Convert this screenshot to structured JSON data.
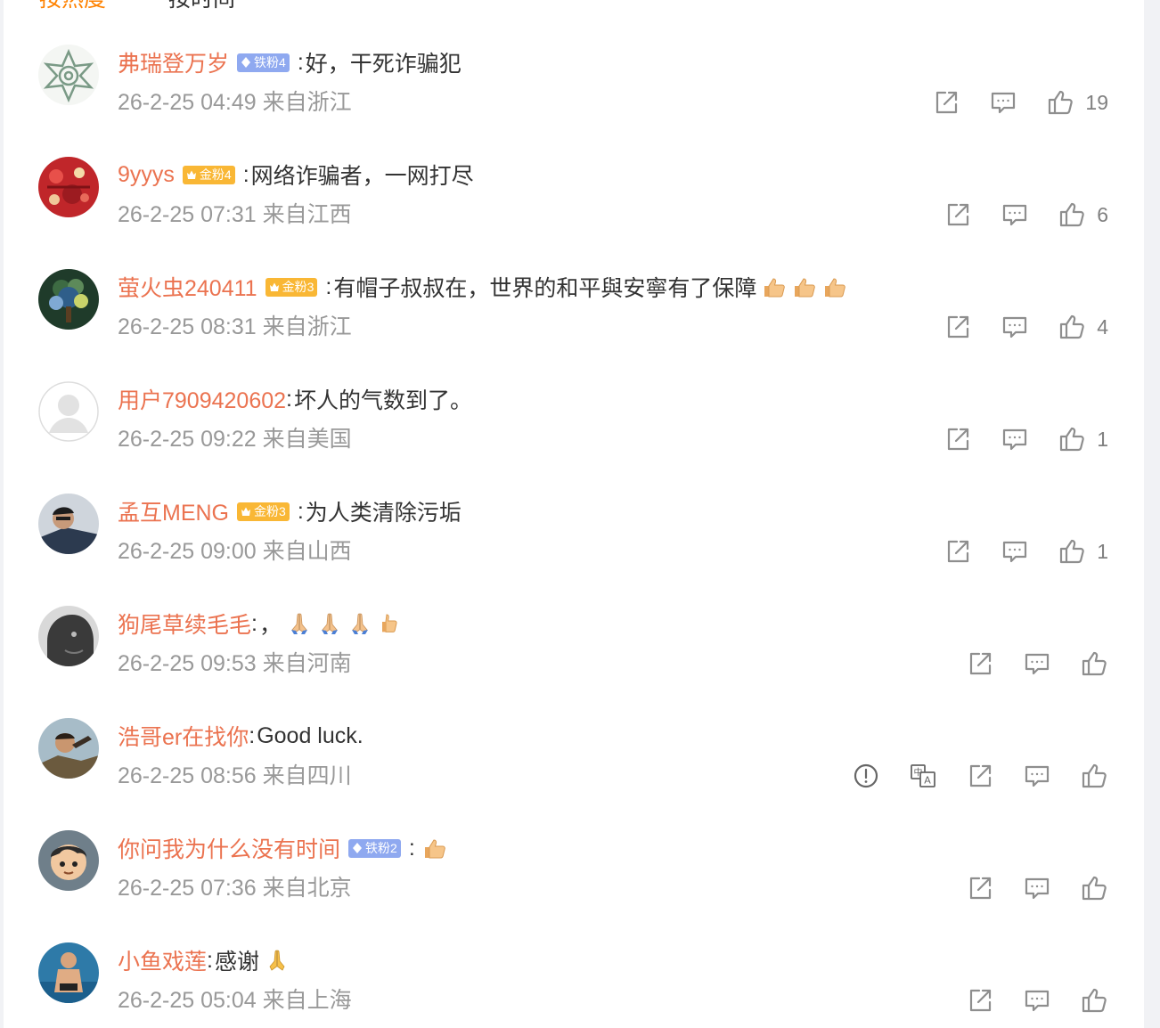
{
  "sort_tabs": {
    "hot": "按热度",
    "time": "按时间"
  },
  "comments": [
    {
      "user": "弗瑞登万岁",
      "badge": "铁粉4",
      "badge_type": "iron",
      "sep": " :",
      "text": "好，干死诈骗犯",
      "time": "26-2-25 04:49",
      "location": "来自浙江",
      "likes": "19",
      "emojis": [],
      "actions": [
        "share",
        "comment",
        "like"
      ],
      "avatar": "emblem",
      "avatar_color": "#7a9a86"
    },
    {
      "user": "9yyys",
      "badge": "金粉4",
      "badge_type": "gold",
      "sep": " :",
      "text": "网络诈骗者，一网打尽",
      "time": "26-2-25 07:31",
      "location": "来自江西",
      "likes": "6",
      "emojis": [],
      "actions": [
        "share",
        "comment",
        "like"
      ],
      "avatar": "red",
      "avatar_color": "#c0262a"
    },
    {
      "user": "萤火虫240411",
      "badge": "金粉3",
      "badge_type": "gold",
      "sep": " :",
      "text": "有帽子叔叔在，世界的和平與安寧有了保障",
      "time": "26-2-25 08:31",
      "location": "来自浙江",
      "likes": "4",
      "emojis": [
        "thumbs-up",
        "thumbs-up",
        "thumbs-up"
      ],
      "actions": [
        "share",
        "comment",
        "like"
      ],
      "avatar": "tree",
      "avatar_color": "#3d6b43"
    },
    {
      "user": "用户7909420602",
      "badge": "",
      "badge_type": "",
      "sep": ":",
      "text": "坏人的气数到了。",
      "time": "26-2-25 09:22",
      "location": "来自美国",
      "likes": "1",
      "emojis": [],
      "actions": [
        "share",
        "comment",
        "like"
      ],
      "avatar": "default",
      "avatar_color": "#e8e8e8"
    },
    {
      "user": "孟互MENG",
      "badge": "金粉3",
      "badge_type": "gold",
      "sep": " :",
      "text": "为人类清除污垢",
      "time": "26-2-25 09:00",
      "location": "来自山西",
      "likes": "1",
      "emojis": [],
      "actions": [
        "share",
        "comment",
        "like"
      ],
      "avatar": "person-dark",
      "avatar_color": "#2c3a4f"
    },
    {
      "user": "狗尾草续毛毛",
      "badge": "",
      "badge_type": "",
      "sep": ":",
      "text": "，",
      "time": "26-2-25 09:53",
      "location": "来自河南",
      "likes": "",
      "emojis": [
        "folded-hands",
        "folded-hands",
        "folded-hands",
        "thumbs-up-small"
      ],
      "actions": [
        "share",
        "comment",
        "like"
      ],
      "avatar": "bw-portrait",
      "avatar_color": "#3a3a3a"
    },
    {
      "user": "浩哥er在找你",
      "badge": "",
      "badge_type": "",
      "sep": ":",
      "text": "Good luck.",
      "time": "26-2-25 08:56",
      "location": "来自四川",
      "likes": "",
      "emojis": [],
      "actions": [
        "report",
        "translate",
        "share",
        "comment",
        "like"
      ],
      "avatar": "person-photo",
      "avatar_color": "#6b5a3e"
    },
    {
      "user": "你问我为什么没有时间",
      "badge": "铁粉2",
      "badge_type": "iron",
      "sep": " :",
      "text": "",
      "time": "26-2-25 07:36",
      "location": "来自北京",
      "likes": "",
      "emojis": [
        "thumbs-up"
      ],
      "actions": [
        "share",
        "comment",
        "like"
      ],
      "avatar": "cartoon",
      "avatar_color": "#6f7f8a"
    },
    {
      "user": "小鱼戏莲",
      "badge": "",
      "badge_type": "",
      "sep": ":",
      "text": "感谢",
      "time": "26-2-25 05:04",
      "location": "来自上海",
      "likes": "",
      "emojis": [
        "folded-hands-gold"
      ],
      "actions": [
        "share",
        "comment",
        "like"
      ],
      "avatar": "swimmer",
      "avatar_color": "#2e7aa8"
    }
  ]
}
